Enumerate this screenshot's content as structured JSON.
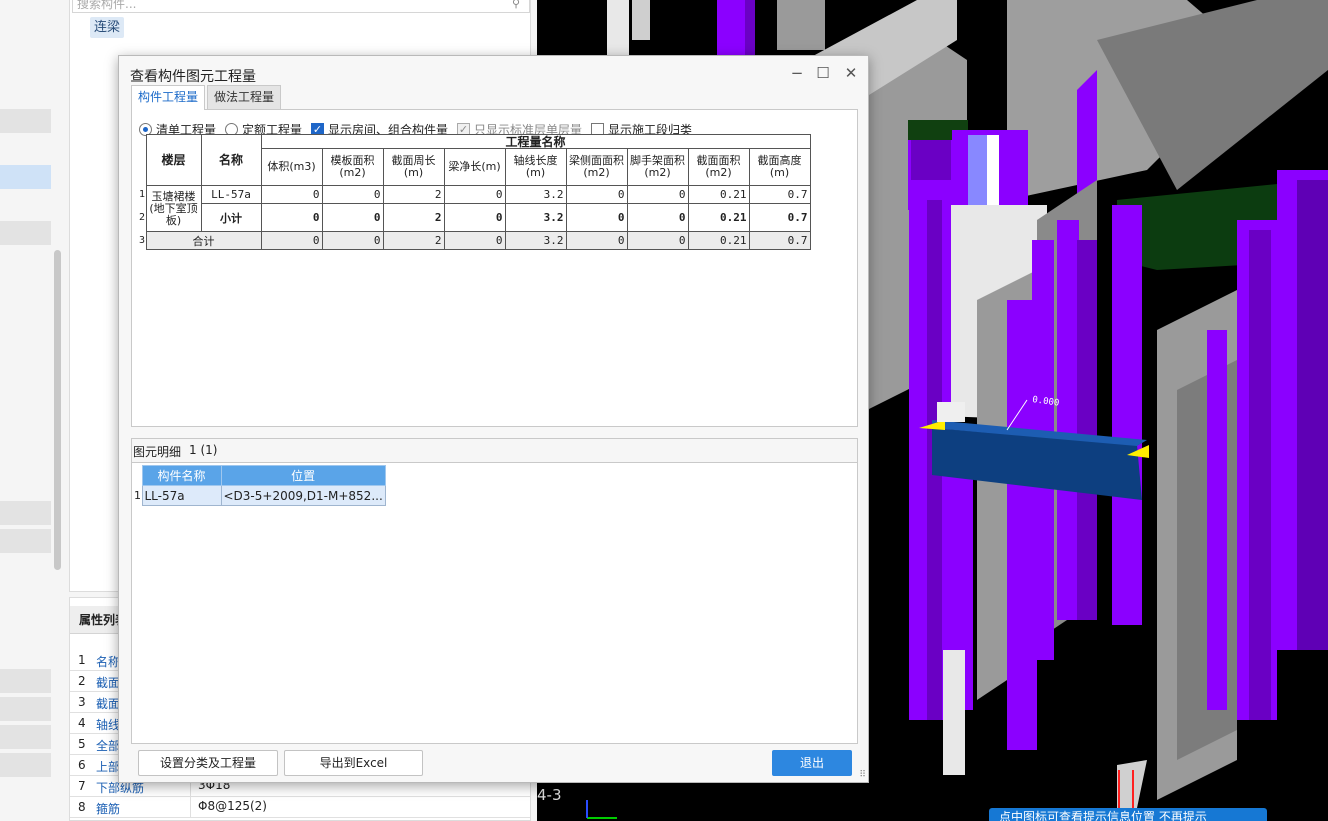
{
  "left": {
    "search_placeholder": "搜索构件...",
    "component_tag": "连梁",
    "attr_title": "属性列表",
    "attr_rows": [
      {
        "n": "1",
        "name": "名称",
        "value": ""
      },
      {
        "n": "2",
        "name": "截面",
        "value": ""
      },
      {
        "n": "3",
        "name": "截面",
        "value": ""
      },
      {
        "n": "4",
        "name": "轴线",
        "value": ""
      },
      {
        "n": "5",
        "name": "全部",
        "value": ""
      },
      {
        "n": "6",
        "name": "上部",
        "value": ""
      },
      {
        "n": "7",
        "name": "下部纵筋",
        "value": "3Φ18"
      },
      {
        "n": "8",
        "name": "箍筋",
        "value": "Φ8@125(2)"
      }
    ]
  },
  "viewport": {
    "axis_label": "4-3",
    "hint": "点中图标可查看提示信息位置    不再提示"
  },
  "dialog": {
    "title": "查看构件图元工程量",
    "tabs": [
      {
        "label": "构件工程量",
        "active": true
      },
      {
        "label": "做法工程量",
        "active": false
      }
    ],
    "options": [
      {
        "type": "radio",
        "label": "清单工程量",
        "checked": true
      },
      {
        "type": "radio",
        "label": "定额工程量",
        "checked": false
      },
      {
        "type": "checkbox",
        "label": "显示房间、组合构件量",
        "checked": true
      },
      {
        "type": "checkbox",
        "label": "只显示标准层单层量",
        "checked": true,
        "disabled": true
      },
      {
        "type": "checkbox",
        "label": "显示施工段归类",
        "checked": false
      }
    ],
    "qty_table": {
      "col_floor": "楼层",
      "col_name": "名称",
      "group_header": "工程量名称",
      "columns": [
        "体积(m3)",
        "模板面积(m2)",
        "截面周长(m)",
        "梁净长(m)",
        "轴线长度(m)",
        "梁侧面面积(m2)",
        "脚手架面积(m2)",
        "截面面积(m2)",
        "截面高度(m)"
      ],
      "floor": "玉塘裙楼(地下室顶板)",
      "rows": [
        {
          "rn": "1",
          "name": "LL-57a",
          "values": [
            "0",
            "0",
            "2",
            "0",
            "3.2",
            "0",
            "0",
            "0.21",
            "0.7"
          ]
        },
        {
          "rn": "2",
          "name": "小计",
          "values": [
            "0",
            "0",
            "2",
            "0",
            "3.2",
            "0",
            "0",
            "0.21",
            "0.7"
          ]
        }
      ],
      "total": {
        "rn": "3",
        "label": "合计",
        "values": [
          "0",
          "0",
          "2",
          "0",
          "3.2",
          "0",
          "0",
          "0.21",
          "0.7"
        ]
      }
    },
    "detail": {
      "label": "图元明细",
      "count": "1 (1)",
      "headers": [
        "构件名称",
        "位置"
      ],
      "rows": [
        {
          "rn": "1",
          "name": "LL-57a",
          "pos": "<D3-5+2009,D1-M+852..."
        }
      ]
    },
    "buttons": {
      "set_class": "设置分类及工程量",
      "export": "导出到Excel",
      "exit": "退出"
    }
  }
}
